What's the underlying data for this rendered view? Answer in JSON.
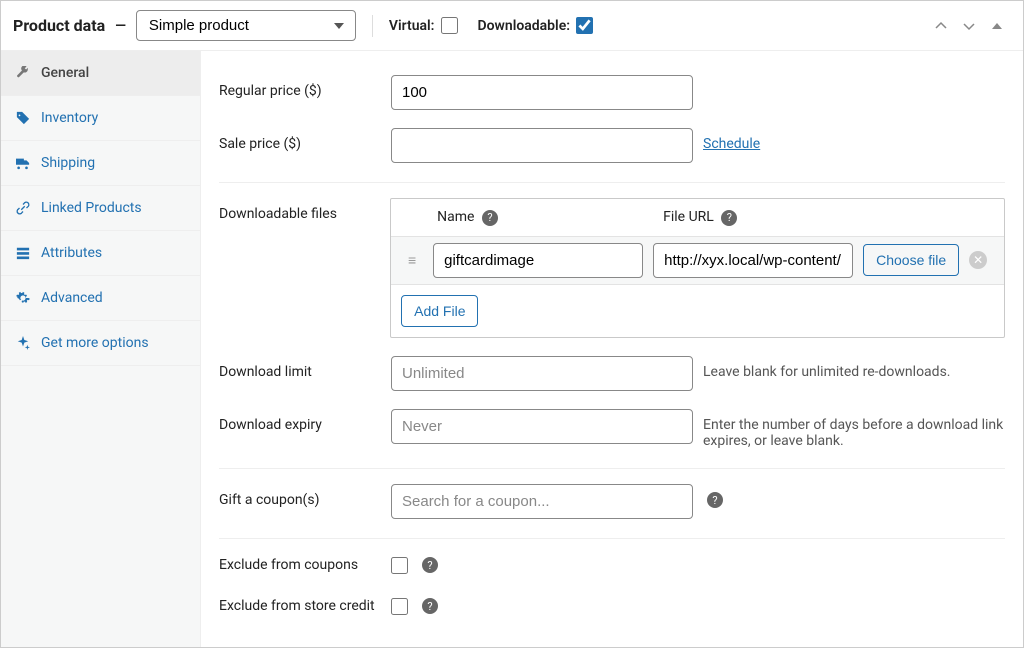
{
  "header": {
    "title": "Product data",
    "product_type": "Simple product",
    "virtual_label": "Virtual:",
    "virtual_checked": false,
    "downloadable_label": "Downloadable:",
    "downloadable_checked": true
  },
  "tabs": [
    {
      "key": "general",
      "label": "General",
      "active": true
    },
    {
      "key": "inventory",
      "label": "Inventory",
      "active": false
    },
    {
      "key": "shipping",
      "label": "Shipping",
      "active": false
    },
    {
      "key": "linked",
      "label": "Linked Products",
      "active": false
    },
    {
      "key": "attributes",
      "label": "Attributes",
      "active": false
    },
    {
      "key": "advanced",
      "label": "Advanced",
      "active": false
    },
    {
      "key": "more",
      "label": "Get more options",
      "active": false
    }
  ],
  "fields": {
    "regular_price": {
      "label": "Regular price ($)",
      "value": "100"
    },
    "sale_price": {
      "label": "Sale price ($)",
      "value": "",
      "schedule_link": "Schedule"
    },
    "downloadable_files": {
      "label": "Downloadable files",
      "col_name": "Name",
      "col_url": "File URL",
      "rows": [
        {
          "name": "giftcardimage",
          "url": "http://xyx.local/wp-content/",
          "choose_label": "Choose file"
        }
      ],
      "add_file_label": "Add File"
    },
    "download_limit": {
      "label": "Download limit",
      "placeholder": "Unlimited",
      "hint": "Leave blank for unlimited re-downloads."
    },
    "download_expiry": {
      "label": "Download expiry",
      "placeholder": "Never",
      "hint": "Enter the number of days before a download link expires, or leave blank."
    },
    "gift_coupons": {
      "label": "Gift a coupon(s)",
      "placeholder": "Search for a coupon..."
    },
    "exclude_coupons": {
      "label": "Exclude from coupons",
      "checked": false
    },
    "exclude_store_credit": {
      "label": "Exclude from store credit",
      "checked": false
    }
  }
}
